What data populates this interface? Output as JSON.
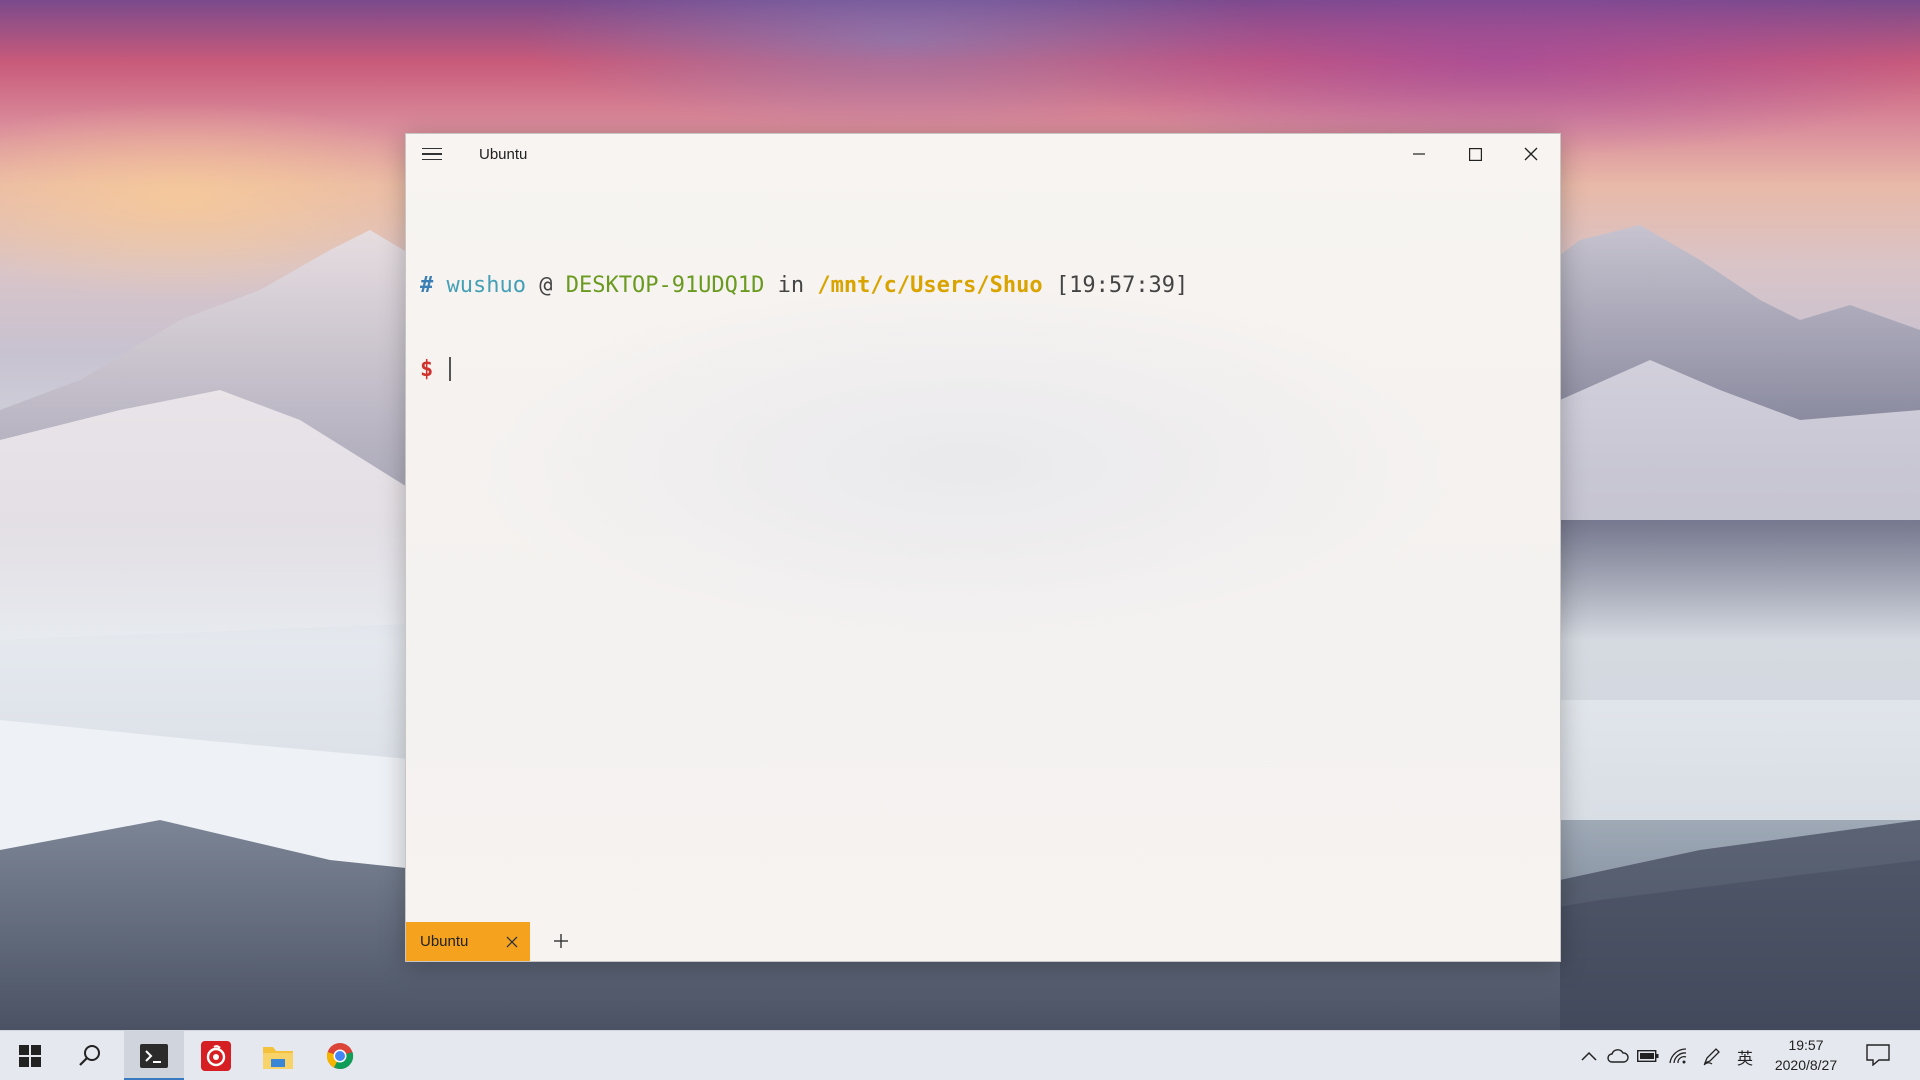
{
  "window": {
    "title": "Ubuntu"
  },
  "terminal": {
    "prompt_hash": "#",
    "user": "wushuo",
    "at": "@",
    "host": "DESKTOP-91UDQ1D",
    "in": "in",
    "path": "/mnt/c/Users/Shuo",
    "time": "[19:57:39]",
    "dollar": "$"
  },
  "tabs": [
    {
      "label": "Ubuntu",
      "active": true
    }
  ],
  "taskbar": {
    "apps": [
      {
        "icon": "windows-start-icon"
      },
      {
        "icon": "search-icon"
      },
      {
        "icon": "terminal-icon",
        "active": true
      },
      {
        "icon": "netease-music-icon"
      },
      {
        "icon": "file-explorer-icon"
      },
      {
        "icon": "chrome-icon"
      }
    ],
    "tray": {
      "icons": [
        "chevron-up-icon",
        "onedrive-icon",
        "battery-icon",
        "wifi-icon",
        "pen-icon"
      ],
      "ime": "英",
      "time": "19:57",
      "date": "2020/8/27"
    }
  },
  "colors": {
    "tab_accent": "#f5a31f",
    "prompt_user": "#45a0b6",
    "prompt_host": "#6a9a1f",
    "prompt_path": "#d9a400",
    "prompt_dollar": "#d0312d",
    "taskbar_active": "#3a7ac0"
  }
}
